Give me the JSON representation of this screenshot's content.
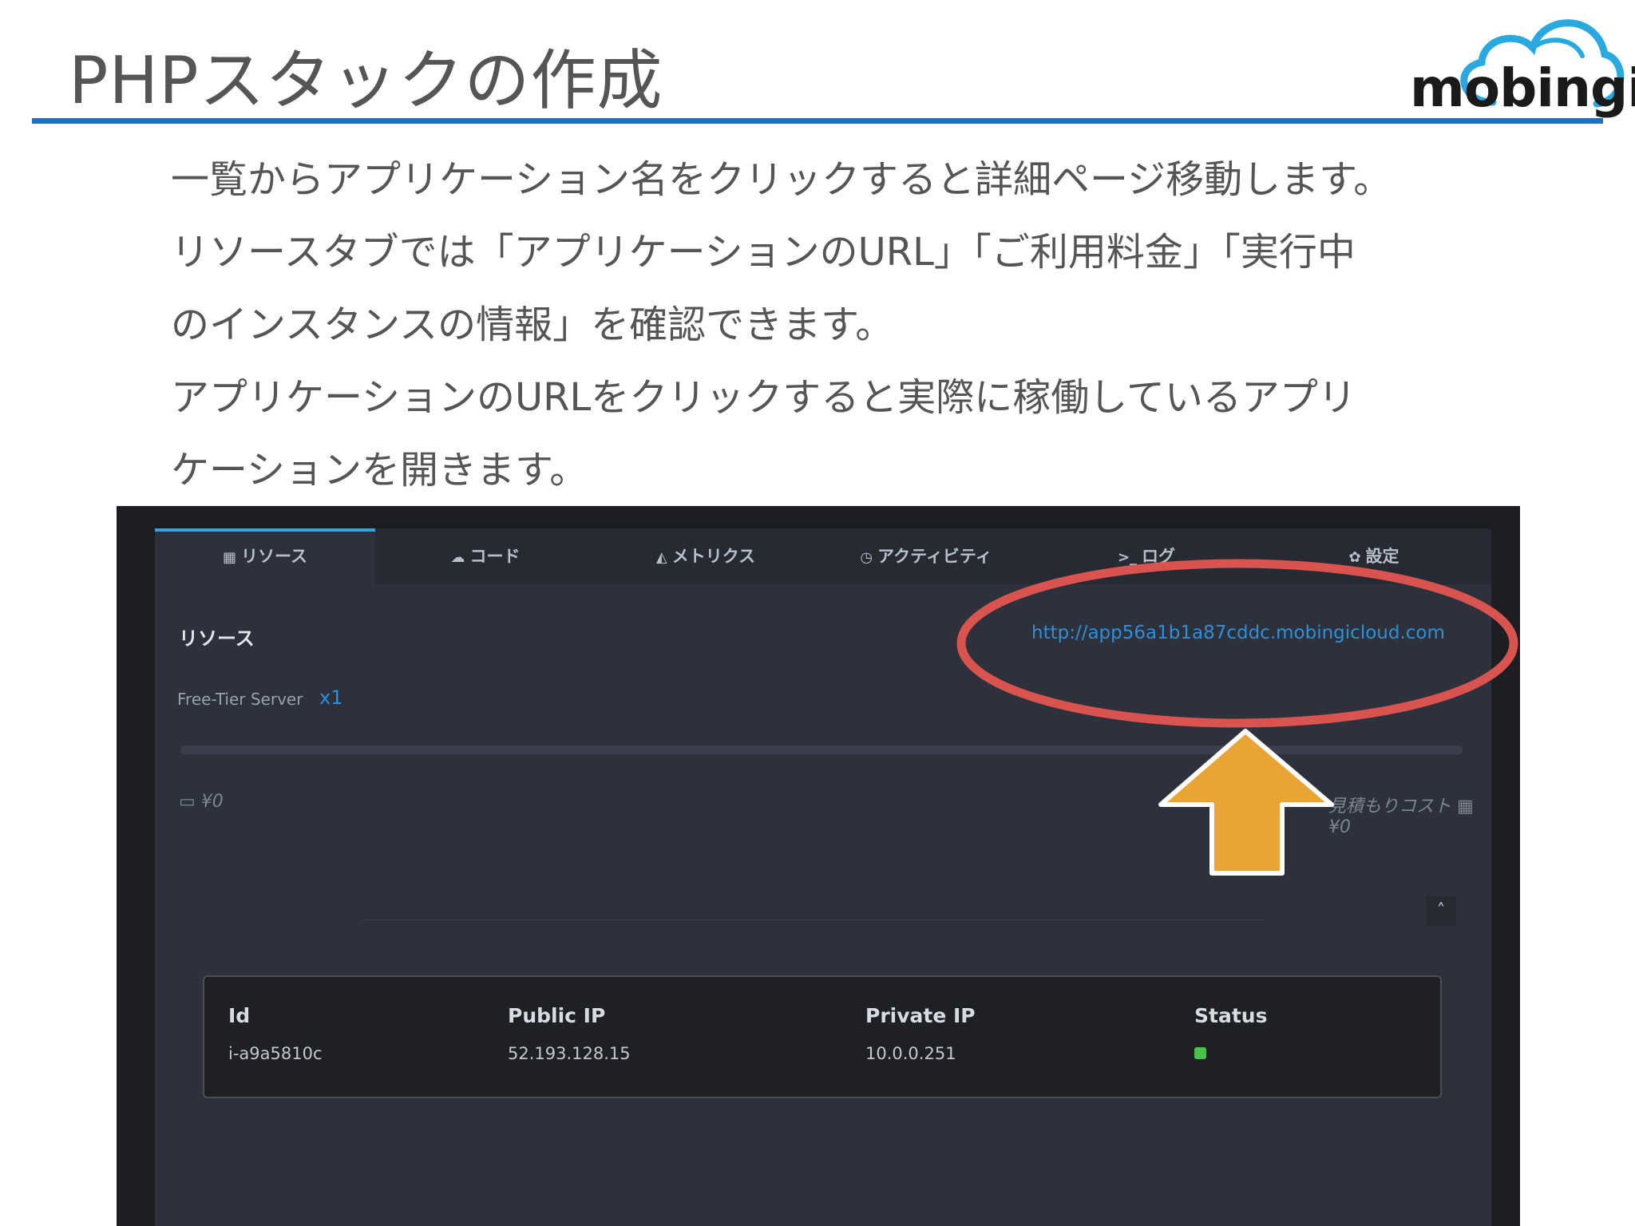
{
  "slide": {
    "title": "PHPスタックの作成",
    "logo_text": "mobingi",
    "paragraphs": [
      "一覧からアプリケーション名をクリックすると詳細ページ移動します。",
      "リソースタブでは「アプリケーションのURL」「ご利用料金」「実行中",
      "のインスタンスの情報」を確認できます。",
      "アプリケーションのURLをクリックすると実際に稼働しているアプリ",
      "ケーションを開きます。"
    ]
  },
  "app": {
    "tabs": [
      {
        "label": "リソース",
        "icon": "grid-icon",
        "glyph": "▦"
      },
      {
        "label": "コード",
        "icon": "cloud-upload-icon",
        "glyph": "☁"
      },
      {
        "label": "メトリクス",
        "icon": "area-chart-icon",
        "glyph": "◭"
      },
      {
        "label": "アクティビティ",
        "icon": "clock-icon",
        "glyph": "◷"
      },
      {
        "label": "ログ",
        "icon": "terminal-icon",
        "glyph": ">_"
      },
      {
        "label": "設定",
        "icon": "gear-icon",
        "glyph": "✿"
      }
    ],
    "resources_heading": "リソース",
    "app_url": "http://app56a1b1a87cddc.mobingicloud.com",
    "server_tier": "Free-Tier Server",
    "server_count": "x1",
    "cost_left": "¥0",
    "cost_right_label": "見積もりコスト",
    "cost_right_value": "¥0",
    "collapse_glyph": "˄",
    "instances": {
      "headers": [
        "Id",
        "Public IP",
        "Private IP",
        "Status"
      ],
      "rows": [
        {
          "id": "i-a9a5810c",
          "public_ip": "52.193.128.15",
          "private_ip": "10.0.0.251",
          "status": "running"
        }
      ]
    }
  },
  "colors": {
    "accent": "#1f6fc5",
    "link": "#2e8fdb",
    "highlight_ellipse": "#d9534f",
    "arrow": "#e9a534",
    "status_running": "#4cc04c"
  }
}
